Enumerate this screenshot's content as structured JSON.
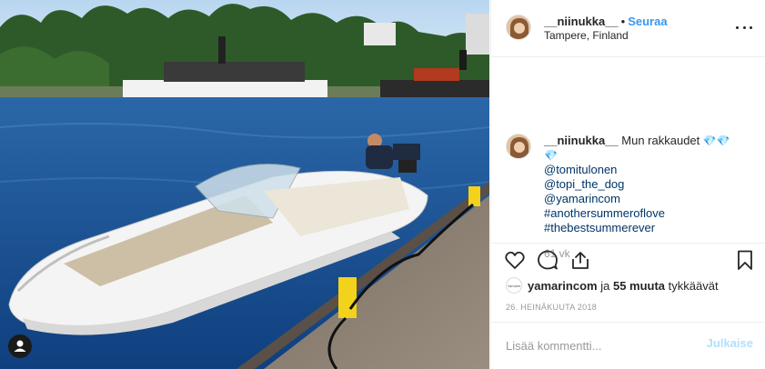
{
  "post": {
    "author": "__niinukka__",
    "follow_label": "Seuraa",
    "dot": "•",
    "location": "Tampere, Finland",
    "image_alt": "Photo of a white motorboat moored at a wooden pier",
    "caption": {
      "username": "__niinukka__",
      "text": "Mun rakkaudet",
      "gem": "💎",
      "tags": [
        "@tomitulonen",
        "@topi_the_dog",
        "@yamarincom",
        "#anothersummeroflove",
        "#thebestsummerever"
      ]
    },
    "time_ago": "61 vk",
    "likes": {
      "liker": "yamarincom",
      "joiner": "ja",
      "count_text": "55 muuta",
      "suffix": "tykkäävät",
      "liker_avatar_text": "Yamarin"
    },
    "date": "26. HEINÄKUUTA 2018",
    "comment": {
      "placeholder": "Lisää kommentti...",
      "post_label": "Julkaise"
    }
  },
  "icons": {
    "more": "more-options-icon",
    "like": "heart-icon",
    "comment": "comment-icon",
    "share": "share-icon",
    "save": "bookmark-icon",
    "user_tag": "user-tag-icon"
  },
  "colors": {
    "link_blue": "#3897f0",
    "hashtag": "#003569",
    "muted": "#999999",
    "post_disabled": "#b2dffc",
    "divider": "#efefef"
  }
}
